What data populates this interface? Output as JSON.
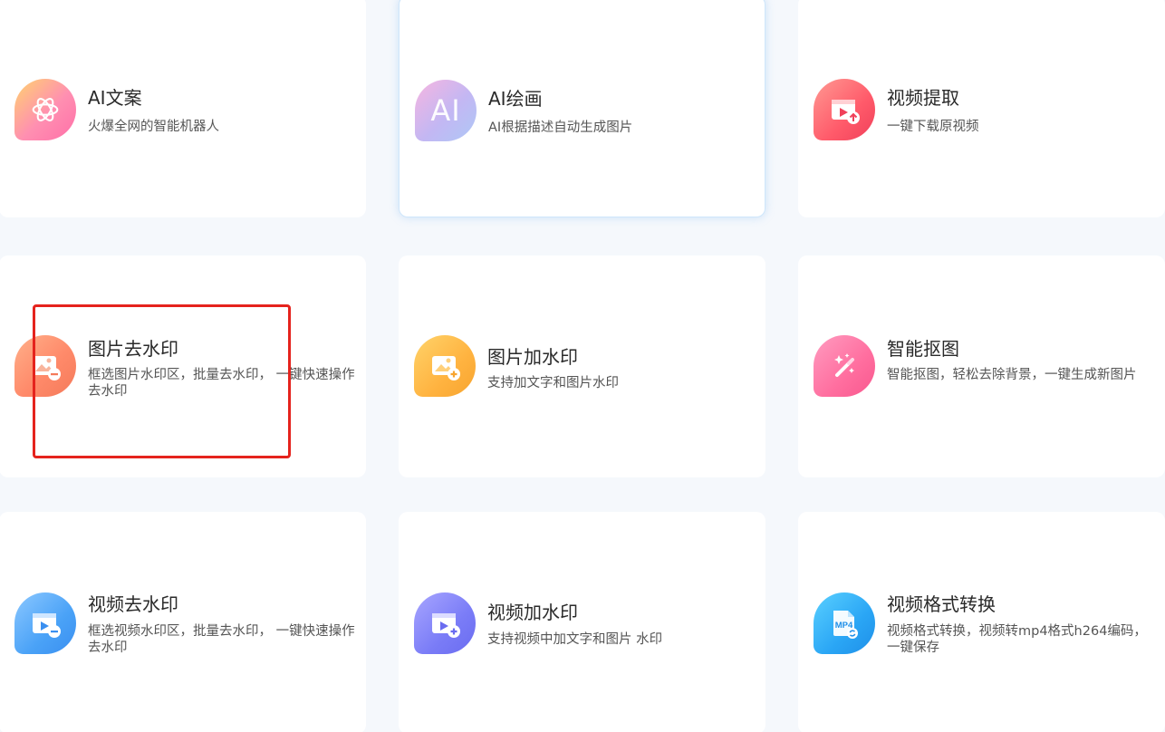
{
  "cards": [
    {
      "title": "AI文案",
      "desc": "火爆全网的智能机器人",
      "icon": "chatgpt-logo-icon"
    },
    {
      "title": "AI绘画",
      "desc": "AI根据描述自动生成图片",
      "icon": "ai-letter-icon",
      "icon_text": "AI"
    },
    {
      "title": "视频提取",
      "desc": "一键下载原视频",
      "icon": "video-extract-icon"
    },
    {
      "title": "图片去水印",
      "desc": "框选图片水印区，批量去水印， 一键快速操作去水印",
      "icon": "image-remove-watermark-icon"
    },
    {
      "title": "图片加水印",
      "desc": "支持加文字和图片水印",
      "icon": "image-add-watermark-icon"
    },
    {
      "title": "智能抠图",
      "desc": "智能抠图，轻松去除背景，一键生成新图片",
      "icon": "magic-wand-icon"
    },
    {
      "title": "视频去水印",
      "desc": "框选视频水印区，批量去水印， 一键快速操作去水印",
      "icon": "video-remove-watermark-icon"
    },
    {
      "title": "视频加水印",
      "desc": "支持视频中加文字和图片 水印",
      "icon": "video-add-watermark-icon"
    },
    {
      "title": "视频格式转换",
      "desc": "视频格式转换，视频转mp4格式h264编码，一键保存",
      "icon": "mp4-convert-icon",
      "icon_text": "MP4"
    }
  ],
  "colors": {
    "highlight": "#e5231d",
    "active_border": "#cfe6fb"
  }
}
